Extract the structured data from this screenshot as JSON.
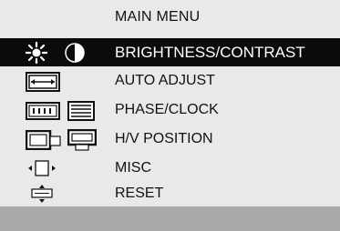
{
  "menu": {
    "title": "MAIN MENU",
    "items": [
      {
        "label": "BRIGHTNESS/CONTRAST",
        "icons": [
          "brightness-icon",
          "contrast-icon"
        ],
        "selected": true
      },
      {
        "label": "AUTO ADJUST",
        "icons": [
          "auto-adjust-icon"
        ],
        "selected": false
      },
      {
        "label": "PHASE/CLOCK",
        "icons": [
          "phase-icon",
          "clock-icon"
        ],
        "selected": false
      },
      {
        "label": "H/V POSITION",
        "icons": [
          "h-position-icon",
          "v-position-icon"
        ],
        "selected": false
      },
      {
        "label": "MISC",
        "icons": [
          "misc-icon"
        ],
        "selected": false
      },
      {
        "label": "RESET",
        "icons": [
          "reset-icon"
        ],
        "selected": false
      }
    ]
  },
  "colors": {
    "panel_bg": "#e9e9e9",
    "selected_bg": "#0b0b0b",
    "selected_text": "#ffffff",
    "text": "#111111",
    "status_bar": "#a9a9a9"
  }
}
